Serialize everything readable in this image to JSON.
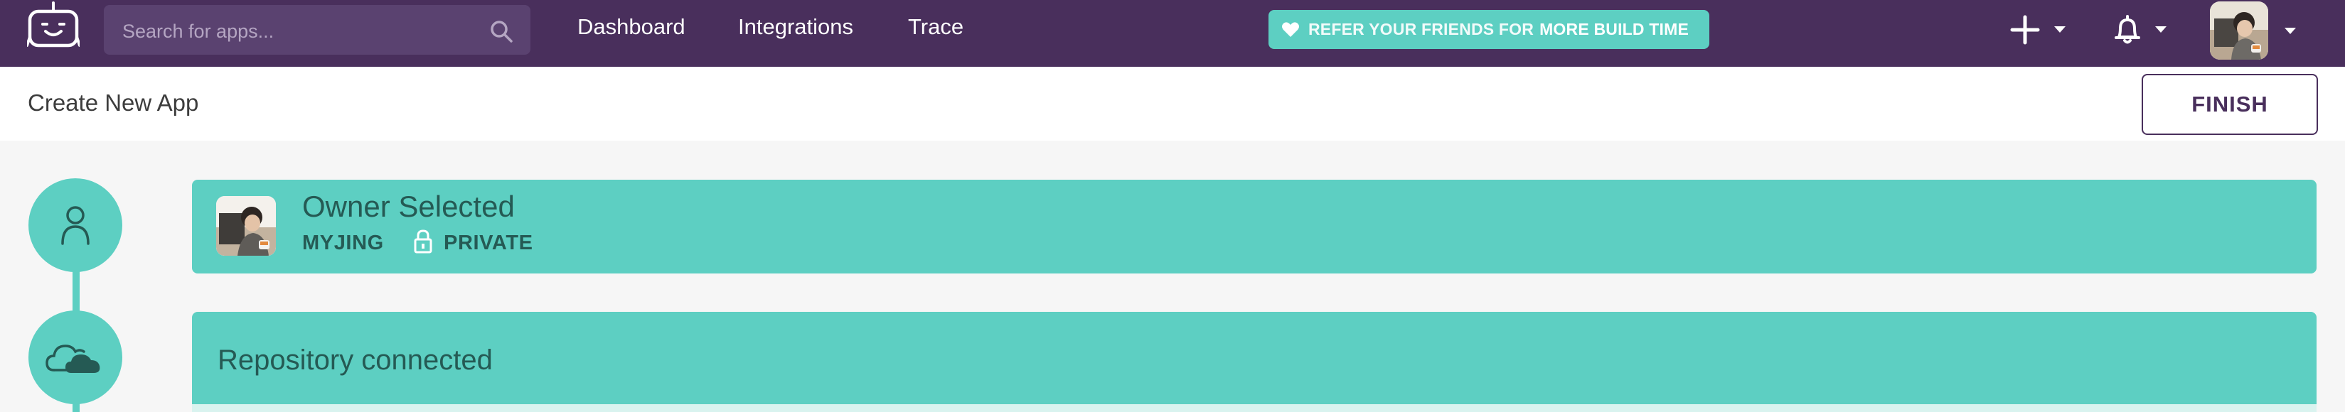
{
  "topbar": {
    "logo_icon": "bitrise-bot-logo-icon",
    "search": {
      "placeholder": "Search for apps...",
      "icon": "search-icon"
    },
    "nav": [
      {
        "label": "Dashboard"
      },
      {
        "label": "Integrations"
      },
      {
        "label": "Trace"
      }
    ],
    "referral": {
      "icon": "heart-icon",
      "prefix": "REFER YOUR FRIENDS FOR",
      "emphasis": "MORE BUILD TIME"
    },
    "actions": {
      "add_icon": "plus-icon",
      "notifications_icon": "bell-icon",
      "profile_icon": "user-avatar"
    }
  },
  "subheader": {
    "title": "Create New App",
    "finish_label": "FINISH"
  },
  "steps": {
    "owner": {
      "icon": "person-icon",
      "title": "Owner Selected",
      "owner_name": "MYJING",
      "visibility_icon": "lock-icon",
      "visibility": "PRIVATE"
    },
    "repository": {
      "icon": "cloud-icon",
      "title": "Repository connected"
    }
  },
  "colors": {
    "topbar_bg": "#492f5c",
    "accent_teal": "#5dcfc2",
    "card_text": "#255a54",
    "page_bg": "#f6f6f6"
  }
}
